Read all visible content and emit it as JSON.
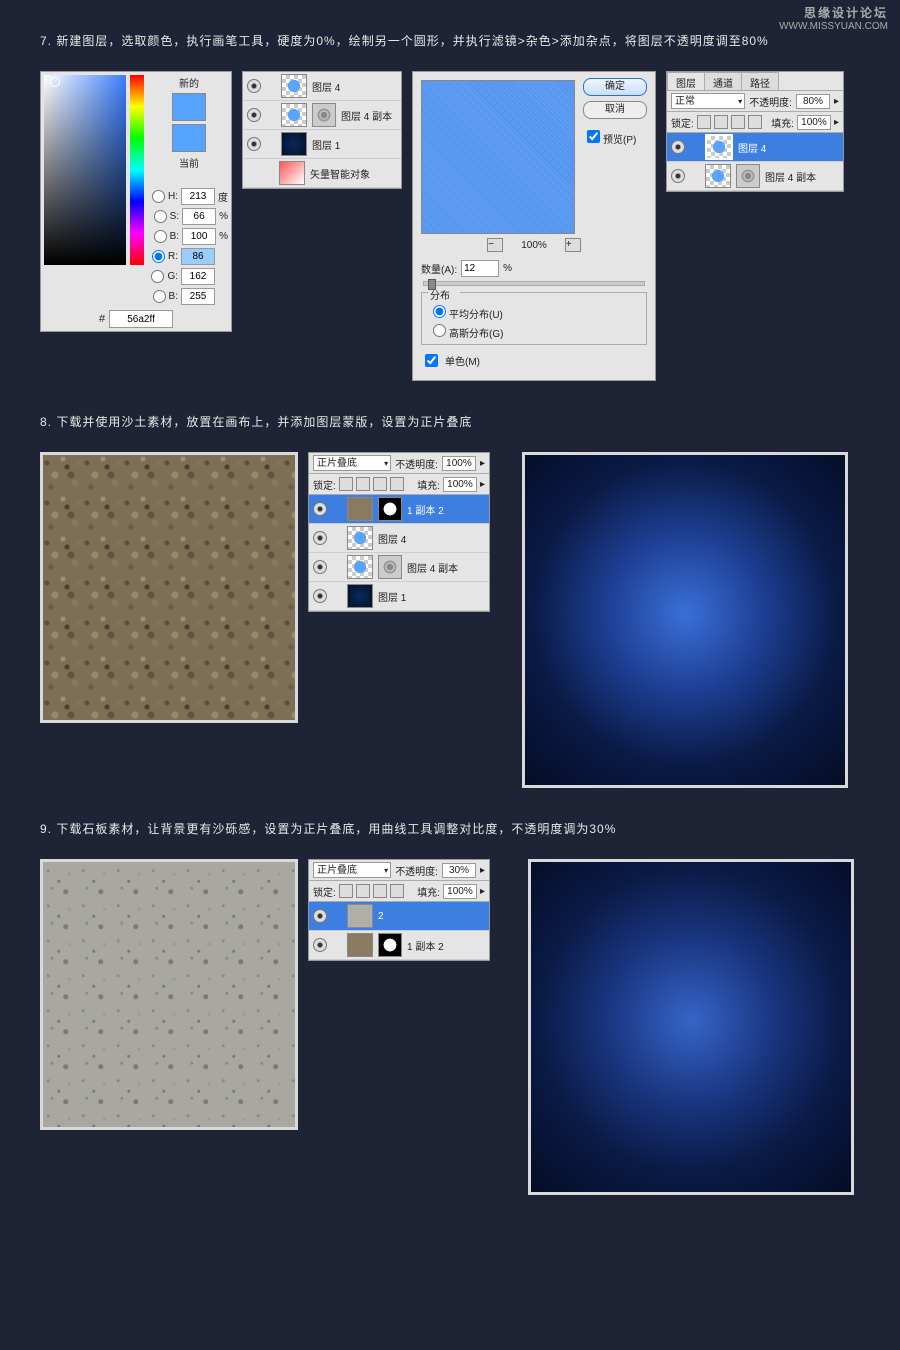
{
  "watermark": {
    "title": "思缘设计论坛",
    "url": "WWW.MISSYUAN.COM"
  },
  "step7": "7. 新建图层，选取颜色，执行画笔工具，硬度为0%，绘制另一个圆形，并执行滤镜>杂色>添加杂点，将图层不透明度调至80%",
  "step8": "8. 下载并使用沙土素材，放置在画布上，并添加图层蒙版，设置为正片叠底",
  "step9": "9. 下载石板素材，让背景更有沙砾感，设置为正片叠底，用曲线工具调整对比度，不透明度调为30%",
  "picker": {
    "new": "新的",
    "current": "当前",
    "H": "H:",
    "Hv": "213",
    "Hu": "度",
    "S": "S:",
    "Sv": "66",
    "Su": "%",
    "B": "B:",
    "Bv": "100",
    "Bu": "%",
    "R": "R:",
    "Rv": "86",
    "G": "G:",
    "Gv": "162",
    "Bc": "B:",
    "Bcv": "255",
    "hex": "#",
    "hexv": "56a2ff"
  },
  "layers7a": {
    "l1": "图层 4",
    "l2": "图层 4 副本",
    "l3": "图层 1",
    "l4": "矢量智能对象"
  },
  "noise": {
    "ok": "确定",
    "cancel": "取消",
    "preview": "预览(P)",
    "zoom": "100%",
    "amount": "数量(A):",
    "amountv": "12",
    "amountu": "%",
    "dist": "分布",
    "uniform": "平均分布(U)",
    "gauss": "高斯分布(G)",
    "mono": "单色(M)"
  },
  "panel7b": {
    "tab1": "图层",
    "tab2": "通道",
    "tab3": "路径",
    "blend": "正常",
    "oplab": "不透明度:",
    "opv": "80%",
    "lock": "锁定:",
    "fill": "填充:",
    "fillv": "100%",
    "l1": "图层 4",
    "l2": "图层 4 副本"
  },
  "panel8": {
    "blend": "正片叠底",
    "oplab": "不透明度:",
    "opv": "100%",
    "lock": "锁定:",
    "fill": "填充:",
    "fillv": "100%",
    "l1": "1 副本 2",
    "l2": "图层 4",
    "l3": "图层 4 副本",
    "l4": "图层 1"
  },
  "panel9": {
    "blend": "正片叠底",
    "oplab": "不透明度:",
    "opv": "30%",
    "lock": "锁定:",
    "fill": "填充:",
    "fillv": "100%",
    "l1": "2",
    "l2": "1 副本 2"
  }
}
